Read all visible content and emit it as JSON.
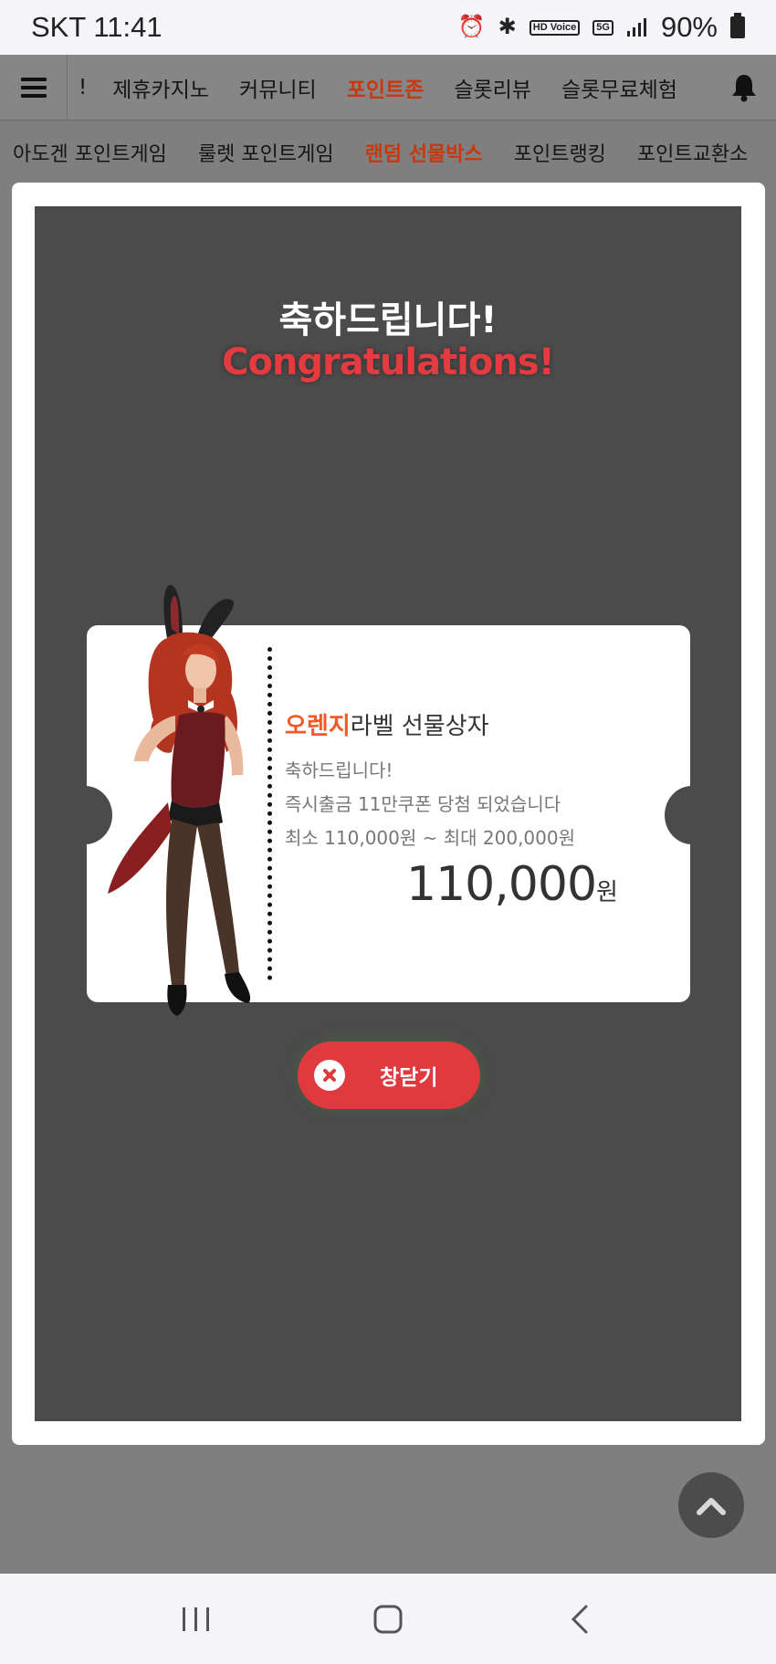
{
  "status_bar": {
    "carrier_time": "SKT 11:41",
    "hd_voice": "HD Voice",
    "network": "5G",
    "battery": "90%"
  },
  "nav": {
    "items": [
      {
        "label": "!",
        "active": false
      },
      {
        "label": "제휴카지노",
        "active": false
      },
      {
        "label": "커뮤니티",
        "active": false
      },
      {
        "label": "포인트존",
        "active": true
      },
      {
        "label": "슬롯리뷰",
        "active": false
      },
      {
        "label": "슬롯무료체험",
        "active": false
      }
    ]
  },
  "sub_nav": {
    "items": [
      {
        "label": "아도겐 포인트게임",
        "active": false
      },
      {
        "label": "룰렛 포인트게임",
        "active": false
      },
      {
        "label": "랜덤 선물박스",
        "active": true
      },
      {
        "label": "포인트랭킹",
        "active": false
      },
      {
        "label": "포인트교환소",
        "active": false
      }
    ]
  },
  "modal": {
    "title_ko": "축하드립니다!",
    "title_en": "Congratulations!",
    "ticket": {
      "heading_accent": "오렌지",
      "heading_rest": "라벨 선물상자",
      "line1": "축하드립니다!",
      "line2": "즉시출금 11만쿠폰 당첨 되었습니다",
      "line3": "최소 110,000원 ~ 최대 200,000원",
      "amount": "110,000",
      "currency": "원"
    },
    "close_label": "창닫기"
  },
  "colors": {
    "accent": "#c8380c",
    "title_red": "#e33b3f",
    "orange": "#ef5a28",
    "close_button": "#e03a3e"
  }
}
